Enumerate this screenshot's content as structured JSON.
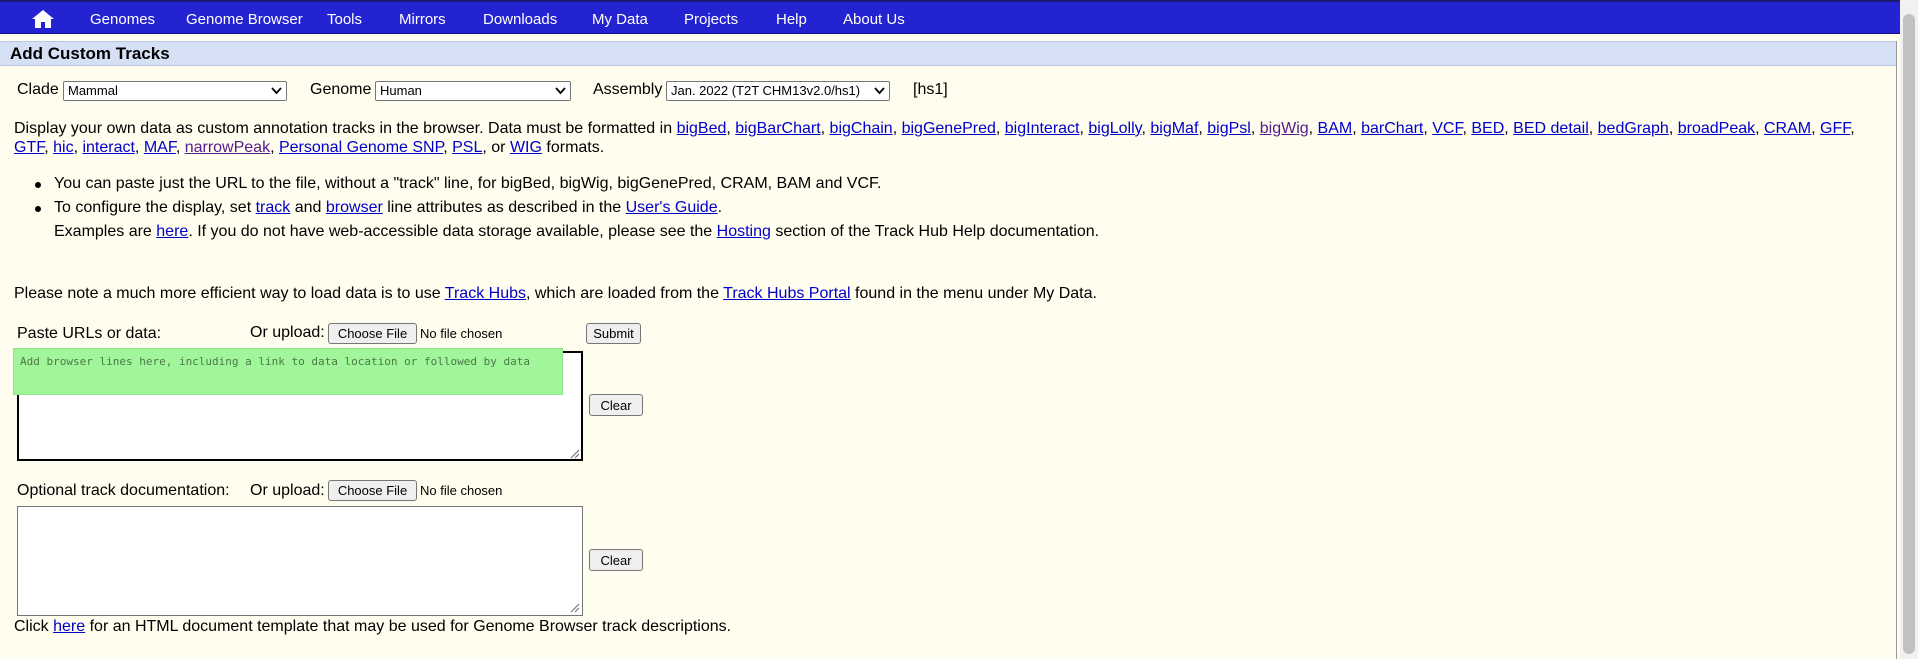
{
  "nav": {
    "home_icon": "home-icon",
    "items": [
      "Genomes",
      "Genome Browser",
      "Tools",
      "Mirrors",
      "Downloads",
      "My Data",
      "Projects",
      "Help",
      "About Us"
    ]
  },
  "header": {
    "title": "Add Custom Tracks"
  },
  "selectors": {
    "clade_label": "Clade",
    "clade_value": "Mammal",
    "genome_label": "Genome",
    "genome_value": "Human",
    "assembly_label": "Assembly",
    "assembly_value": "Jan. 2022 (T2T CHM13v2.0/hs1)",
    "db_tag": "[hs1]"
  },
  "intro": {
    "prefix": "Display your own data as custom annotation tracks in the browser. Data must be formatted in",
    "formats_line1": [
      "bigBed",
      "bigBarChart",
      "bigChain",
      "bigGenePred",
      "bigInteract",
      "bigLolly",
      "bigMaf",
      "bigPsl",
      "bigWig",
      "BAM",
      "barChart",
      "VCF",
      "BED",
      "BED detail",
      "bedGraph",
      "broadPeak",
      "CRAM",
      "GFF"
    ],
    "formats_line2": [
      "GTF",
      "hic",
      "interact",
      "MAF",
      "narrowPeak",
      "Personal Genome SNP",
      "PSL"
    ],
    "or_text": ", or",
    "last_format": "WIG",
    "suffix": "formats."
  },
  "bullets": {
    "b1": "You can paste just the URL to the file, without a \"track\" line, for bigBed, bigWig, bigGenePred, CRAM, BAM and VCF.",
    "b2_a": "To configure the display, set",
    "b2_link1": "track",
    "b2_b": "and",
    "b2_link2": "browser",
    "b2_c": "line attributes as described in the",
    "b2_link3": "User's Guide",
    "b2_d": ".",
    "b3_a": "Examples are",
    "b3_link1": "here",
    "b3_b": ". If you do not have web-accessible data storage available, please see the",
    "b3_link2": "Hosting",
    "b3_c": "section of the Track Hub Help documentation."
  },
  "note": {
    "a": "Please note a much more efficient way to load data is to use",
    "link1": "Track Hubs",
    "b": ", which are loaded from the",
    "link2": "Track Hubs Portal",
    "c": "found in the menu under My Data."
  },
  "paste": {
    "label": "Paste URLs or data:",
    "or_upload": "Or upload:",
    "choose_file": "Choose File",
    "no_file": "No file chosen",
    "submit": "Submit",
    "placeholder": "Add browser lines here, including a link to data location or followed by data",
    "clear": "Clear"
  },
  "doc": {
    "label": "Optional track documentation:",
    "or_upload": "Or upload:",
    "choose_file": "Choose File",
    "no_file": "No file chosen",
    "clear": "Clear"
  },
  "footer": {
    "a": "Click",
    "link": "here",
    "b": "for an HTML document template that may be used for Genome Browser track descriptions."
  }
}
